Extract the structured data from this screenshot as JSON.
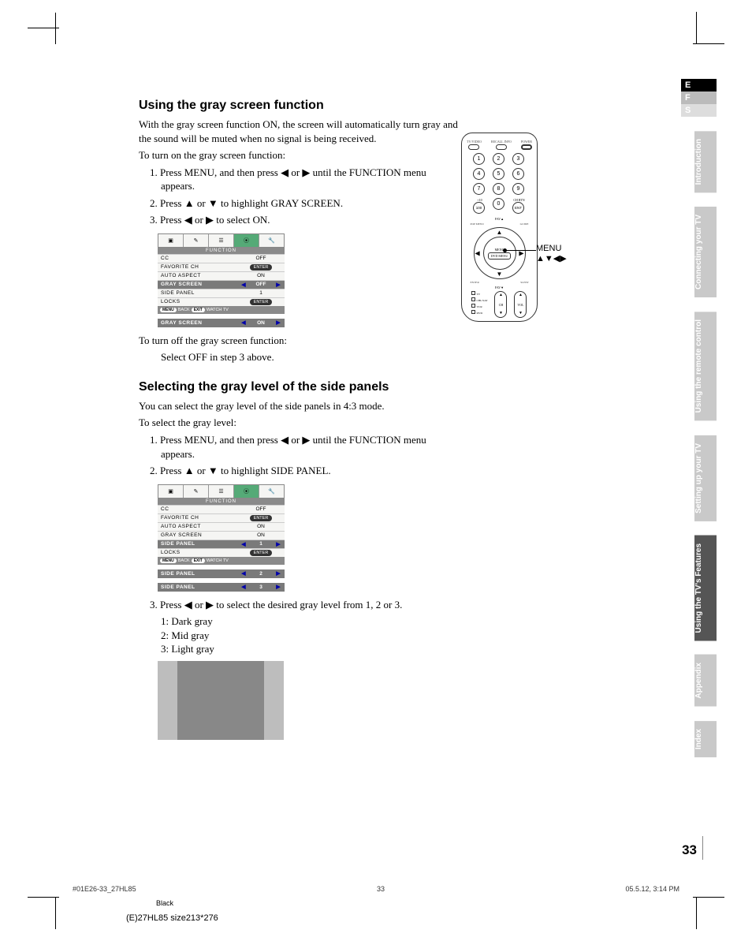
{
  "tabs": {
    "lang": [
      "E",
      "F",
      "S"
    ],
    "sections": [
      "Introduction",
      "Connecting your TV",
      "Using the remote control",
      "Setting up your TV",
      "Using the TV's Features",
      "Appendix",
      "Index"
    ]
  },
  "s1": {
    "heading": "Using the gray screen function",
    "intro": "With the gray screen function ON, the screen will automatically turn gray and the sound will be muted when no signal is being received.",
    "lead": "To turn on the gray screen function:",
    "steps": [
      "Press MENU, and then press ◀ or ▶ until the FUNCTION menu appears.",
      "Press ▲ or ▼ to highlight GRAY SCREEN.",
      "Press ◀ or ▶ to select ON."
    ],
    "off_lead": "To turn off the gray screen function:",
    "off_step": "Select OFF in step 3 above."
  },
  "osd1": {
    "title": "FUNCTION",
    "rows": [
      {
        "label": "CC",
        "val": "OFF",
        "enter": false,
        "hl": false,
        "arrows": false
      },
      {
        "label": "FAVORITE CH",
        "val": "",
        "enter": true,
        "hl": false,
        "arrows": false
      },
      {
        "label": "AUTO ASPECT",
        "val": "ON",
        "enter": false,
        "hl": false,
        "arrows": false
      },
      {
        "label": "GRAY SCREEN",
        "val": "OFF",
        "enter": false,
        "hl": true,
        "arrows": true
      },
      {
        "label": "SIDE PANEL",
        "val": "1",
        "enter": false,
        "hl": false,
        "arrows": false
      },
      {
        "label": "LOCKS",
        "val": "",
        "enter": true,
        "hl": false,
        "arrows": false
      }
    ],
    "foot": [
      "MENU",
      "BACK",
      "EXIT",
      "WATCH TV"
    ],
    "single": {
      "label": "GRAY SCREEN",
      "val": "ON"
    }
  },
  "s2": {
    "heading": "Selecting the gray level of the side panels",
    "intro": "You can select the gray level of the side panels in 4:3 mode.",
    "lead": "To select the gray level:",
    "steps": [
      "Press MENU, and then press ◀ or ▶ until the FUNCTION menu appears.",
      "Press ▲ or ▼ to highlight SIDE PANEL."
    ],
    "step3": "Press ◀ or ▶ to select the desired gray level from 1, 2 or 3.",
    "levels": [
      "1: Dark gray",
      "2: Mid gray",
      "3: Light gray"
    ]
  },
  "osd2": {
    "title": "FUNCTION",
    "rows": [
      {
        "label": "CC",
        "val": "OFF",
        "enter": false,
        "hl": false,
        "arrows": false
      },
      {
        "label": "FAVORITE CH",
        "val": "",
        "enter": true,
        "hl": false,
        "arrows": false
      },
      {
        "label": "AUTO ASPECT",
        "val": "ON",
        "enter": false,
        "hl": false,
        "arrows": false
      },
      {
        "label": "GRAY SCREEN",
        "val": "ON",
        "enter": false,
        "hl": false,
        "arrows": false
      },
      {
        "label": "SIDE PANEL",
        "val": "1",
        "enter": false,
        "hl": true,
        "arrows": true
      },
      {
        "label": "LOCKS",
        "val": "",
        "enter": true,
        "hl": false,
        "arrows": false
      }
    ],
    "foot": [
      "MENU",
      "BACK",
      "EXIT",
      "WATCH TV"
    ],
    "singles": [
      {
        "label": "SIDE PANEL",
        "val": "2"
      },
      {
        "label": "SIDE PANEL",
        "val": "3"
      }
    ]
  },
  "remote": {
    "top": [
      "TV/VIDEO",
      "RECALL INFO",
      "POWER"
    ],
    "nums": [
      "1",
      "2",
      "3",
      "4",
      "5",
      "6",
      "7",
      "8",
      "9",
      "100",
      "0",
      "ENT"
    ],
    "sublabels": {
      "left": "+10",
      "right": "CH RTN"
    },
    "fav": "FAV▲",
    "dpad_top_left": "POP MENU",
    "dpad_top_right": "GUIDE",
    "dpad_center_top": "MENU",
    "dpad_center_bot": "DVD MENU",
    "dpad_bot_left": "ENTER",
    "dpad_bot_right": "SLEEP",
    "favdown": "FAV▼",
    "side_items": [
      "TV",
      "CBL/SAT",
      "VCR",
      "DVD"
    ],
    "rockers": [
      "CH",
      "VOL"
    ]
  },
  "callout": {
    "label": "MENU",
    "arrows": "▲▼◀▶"
  },
  "page": "33",
  "footer": {
    "file": "#01E26-33_27HL85",
    "page": "33",
    "date": "05.5.12, 3:14 PM",
    "black": "Black",
    "size": "(E)27HL85 size213*276"
  }
}
